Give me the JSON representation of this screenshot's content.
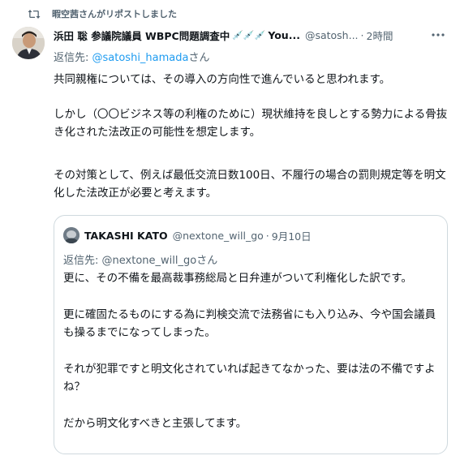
{
  "repost": {
    "text": "暇空茜さんがリポストしました",
    "icon": "repost-icon"
  },
  "tweet": {
    "author_name": "浜田 聡 参議院議員 WBPC問題調査中",
    "syringe_icons": "💉💉💉",
    "author_tail": "You...",
    "handle": "@satosh...",
    "separator": "·",
    "time": "2時間",
    "more_icon": "more-icon",
    "reply_prefix": "返信先: ",
    "reply_handle": "@satoshi_hamada",
    "reply_suffix": "さん",
    "paragraph1": "共同親権については、その導入の方向性で進んでいると思われます。",
    "paragraph2": "しかし（〇〇ビジネス等の利権のために）現状維持を良しとする勢力による骨抜き化された法改正の可能性を想定します。",
    "paragraph3": "その対策として、例えば最低交流日数100日、不履行の場合の罰則規定等を明文化した法改正が必要と考えます。"
  },
  "quote": {
    "author_name": "TAKASHI KATO",
    "handle": "@nextone_will_go",
    "separator": "·",
    "time": "9月10日",
    "reply_prefix": "返信先: ",
    "reply_handle": "@nextone_will_go",
    "reply_suffix": "さん",
    "paragraph1": "更に、その不備を最高裁事務総局と日弁連がついて利権化した訳です。",
    "paragraph2": "更に確固たるものにする為に判検交流で法務省にも入り込み、今や国会議員も操るまでになってしまった。",
    "paragraph3": "それが犯罪ですと明文化されていれば起きてなかった、要は法の不備ですよね？",
    "paragraph4": "だから明文化すべきと主張してます。"
  },
  "colors": {
    "link": "#1d9bf0",
    "muted": "#536471",
    "text": "#0f1419",
    "border": "#cfd9de"
  }
}
